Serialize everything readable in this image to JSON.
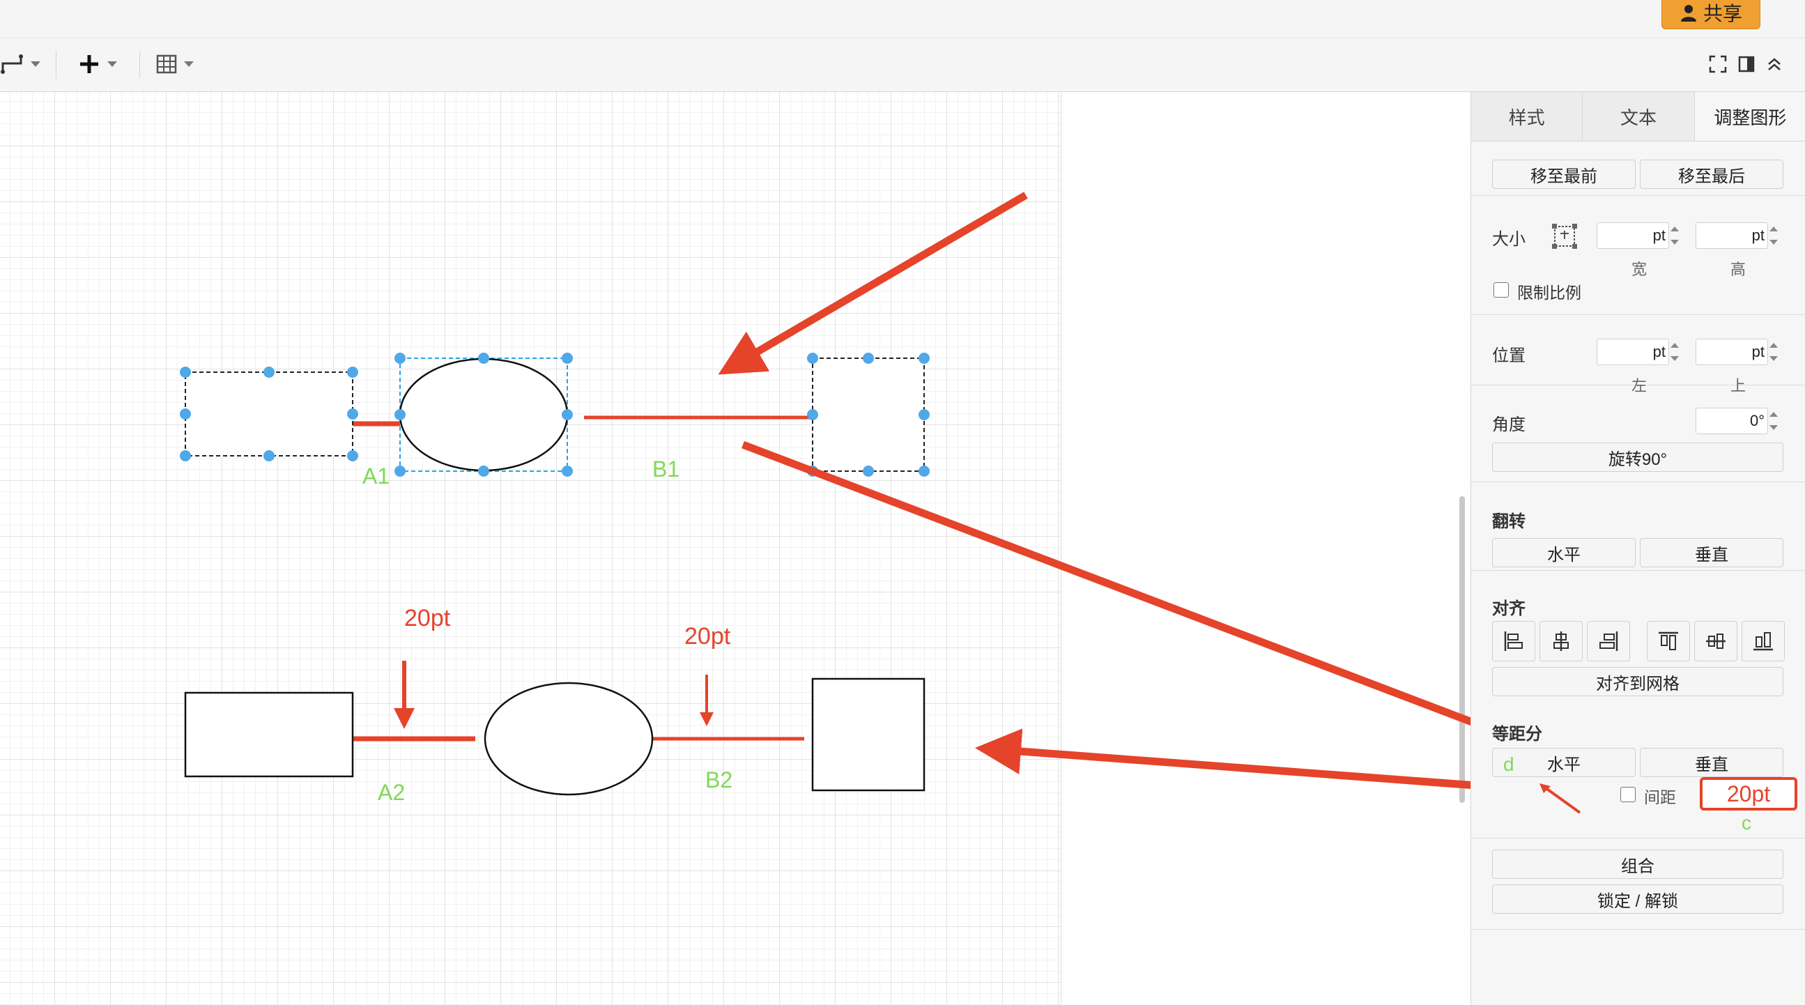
{
  "topbar": {
    "share_label": "共享",
    "share_color": "#f0a030"
  },
  "toolbar": {
    "icons": [
      "connector-style-icon",
      "plus-icon",
      "table-icon",
      "fullscreen-icon",
      "format-panel-icon",
      "collapse-icon"
    ]
  },
  "annotations": {
    "a1": "A1",
    "b1": "B1",
    "a2": "A2",
    "b2": "B2",
    "pt_a2": "20pt",
    "pt_b2": "20pt",
    "highlight_value": "20pt",
    "note_c": "c",
    "note_d": "d",
    "line_color": "#e5432a",
    "label_color": "#7ed957"
  },
  "panel": {
    "tabs": [
      "样式",
      "文本",
      "调整图形"
    ],
    "active_tab": 2,
    "arrange": {
      "to_front": "移至最前",
      "to_back": "移至最后"
    },
    "size": {
      "label": "大小",
      "width_value": "pt",
      "height_value": "pt",
      "width_caption": "宽",
      "height_caption": "高",
      "constrain": "限制比例"
    },
    "position": {
      "label": "位置",
      "left_value": "pt",
      "top_value": "pt",
      "left_caption": "左",
      "top_caption": "上"
    },
    "angle": {
      "label": "角度",
      "value": "0°",
      "rotate": "旋转90°"
    },
    "flip": {
      "label": "翻转",
      "horizontal": "水平",
      "vertical": "垂直"
    },
    "align": {
      "label": "对齐",
      "to_grid": "对齐到网格"
    },
    "distribute": {
      "label": "等距分",
      "horizontal": "水平",
      "vertical": "垂直",
      "spacing": "间距"
    },
    "group": "组合",
    "lock": "锁定 / 解锁"
  }
}
